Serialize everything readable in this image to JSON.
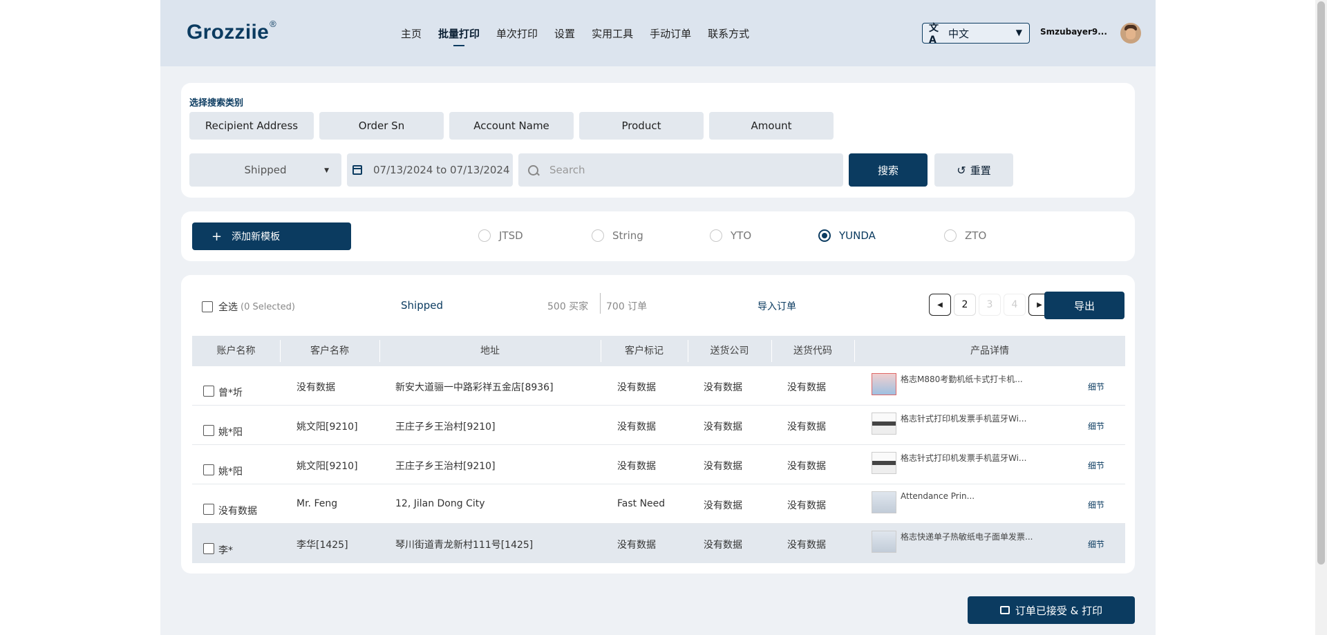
{
  "header": {
    "logo": "Grozziie",
    "logo_mark": "®",
    "nav": [
      "主页",
      "批量打印",
      "单次打印",
      "设置",
      "实用工具",
      "手动订单",
      "联系方式"
    ],
    "active_nav": "批量打印",
    "language": "中文",
    "language_icon": "translate-icon",
    "username": "Smzubayer9..."
  },
  "search_panel": {
    "section_title": "选择搜索类别",
    "categories": [
      "Recipient Address",
      "Order Sn",
      "Account Name",
      "Product",
      "Amount"
    ],
    "status_value": "Shipped",
    "date_range": "07/13/2024 to 07/13/2024",
    "search_placeholder": "Search",
    "search_button": "搜索",
    "reset_button": "重置"
  },
  "carrier_panel": {
    "add_template_button": "添加新模板",
    "carriers": [
      "JTSD",
      "String",
      "YTO",
      "YUNDA",
      "ZTO"
    ],
    "selected_carrier": "YUNDA"
  },
  "orders": {
    "select_all": "全选",
    "selected_count": "(0 Selected)",
    "status_tab": "Shipped",
    "buyers": "500 买家",
    "orders_count": "700 订单",
    "import_link": "导入订单",
    "pagination": {
      "pages": [
        "2",
        "3",
        "4"
      ],
      "current": "2"
    },
    "export_button": "导出",
    "columns": [
      "账户名称",
      "客户名称",
      "地址",
      "客户标记",
      "送货公司",
      "送货代码",
      "产品详情"
    ],
    "detail_label": "细节",
    "rows": [
      {
        "account": "曾*圻",
        "customer": "没有数据",
        "address": "新安大道骊一中路彩祥五金店[8936]",
        "mark": "没有数据",
        "company": "没有数据",
        "code": "没有数据",
        "product": "格志M880考勤机纸卡式打卡机..."
      },
      {
        "account": "姚*阳",
        "customer": "姚文阳[9210]",
        "address": "王庄子乡王治村[9210]",
        "mark": "没有数据",
        "company": "没有数据",
        "code": "没有数据",
        "product": "格志针式打印机发票手机蓝牙Wi..."
      },
      {
        "account": "姚*阳",
        "customer": "姚文阳[9210]",
        "address": "王庄子乡王治村[9210]",
        "mark": "没有数据",
        "company": "没有数据",
        "code": "没有数据",
        "product": "格志针式打印机发票手机蓝牙Wi..."
      },
      {
        "account": "没有数据",
        "customer": "Mr. Feng",
        "address": "12, Jilan Dong City",
        "mark": "Fast Need",
        "company": "没有数据",
        "code": "没有数据",
        "product": "Attendance Prin..."
      },
      {
        "account": "李*",
        "customer": "李华[1425]",
        "address": "琴川街道青龙新村111号[1425]",
        "mark": "没有数据",
        "company": "没有数据",
        "code": "没有数据",
        "product": "格志快递单子热敏纸电子面单发票..."
      }
    ]
  },
  "footer": {
    "print_button": "订单已接受 & 打印"
  },
  "colors": {
    "primary": "#0b3b60",
    "header_bg": "#dce4ee",
    "page_bg": "#eef1f5"
  }
}
